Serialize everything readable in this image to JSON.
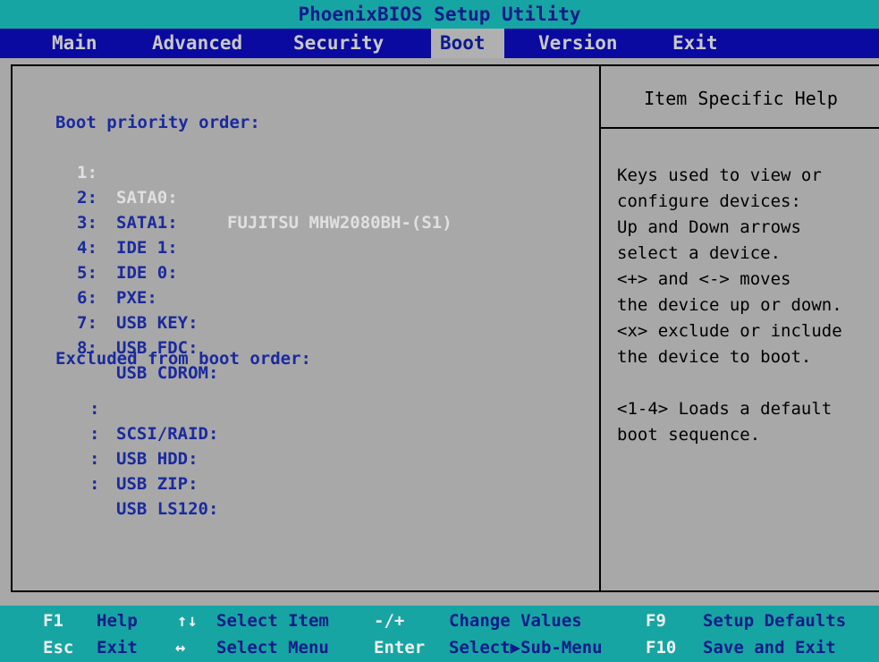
{
  "title": "PhoenixBIOS Setup Utility",
  "menu": [
    "Main",
    "Advanced",
    "Security",
    "Boot",
    "Version",
    "Exit"
  ],
  "active_menu": "Boot",
  "boot": {
    "priority_heading": "Boot priority order:",
    "priority_items": [
      {
        "num": "1:",
        "device": "SATA0:",
        "detail": "FUJITSU MHW2080BH-(S1)"
      },
      {
        "num": "2:",
        "device": "SATA1:"
      },
      {
        "num": "3:",
        "device": "IDE 1:"
      },
      {
        "num": "4:",
        "device": "IDE 0:"
      },
      {
        "num": "5:",
        "device": "PXE:"
      },
      {
        "num": "6:",
        "device": "USB KEY:"
      },
      {
        "num": "7:",
        "device": "USB FDC:"
      },
      {
        "num": "8:",
        "device": "USB CDROM:"
      }
    ],
    "excluded_heading": "Excluded from boot order:",
    "excluded_items": [
      {
        "num": ":",
        "device": "SCSI/RAID:"
      },
      {
        "num": ":",
        "device": "USB HDD:"
      },
      {
        "num": ":",
        "device": "USB ZIP:"
      },
      {
        "num": ":",
        "device": "USB LS120:"
      }
    ]
  },
  "help": {
    "title": "Item Specific Help",
    "text": "Keys used to view or\nconfigure devices:\nUp and Down arrows\nselect a device.\n<+> and <-> moves\nthe device up or down.\n<x> exclude or include\nthe device to boot.\n\n<1-4> Loads a default\nboot sequence."
  },
  "status": {
    "row1": [
      {
        "key": "F1",
        "desc": "Help"
      },
      {
        "key": "↑↓",
        "desc": "Select Item"
      },
      {
        "key": "-/+",
        "desc": "Change Values"
      },
      {
        "key": "F9",
        "desc": "Setup Defaults"
      }
    ],
    "row2": [
      {
        "key": "Esc",
        "desc": "Exit"
      },
      {
        "key": "↔",
        "desc": "Select Menu"
      },
      {
        "key": "Enter",
        "desc": "Select▶Sub-Menu"
      },
      {
        "key": "F10",
        "desc": "Save and Exit"
      }
    ]
  },
  "colors": {
    "cyan": "#17a5a3",
    "menu_blue": "#0a0aa0",
    "text_blue": "#1a2a9e",
    "panel_gray": "#a8a8a8",
    "selected_white": "#e0e0e0"
  }
}
